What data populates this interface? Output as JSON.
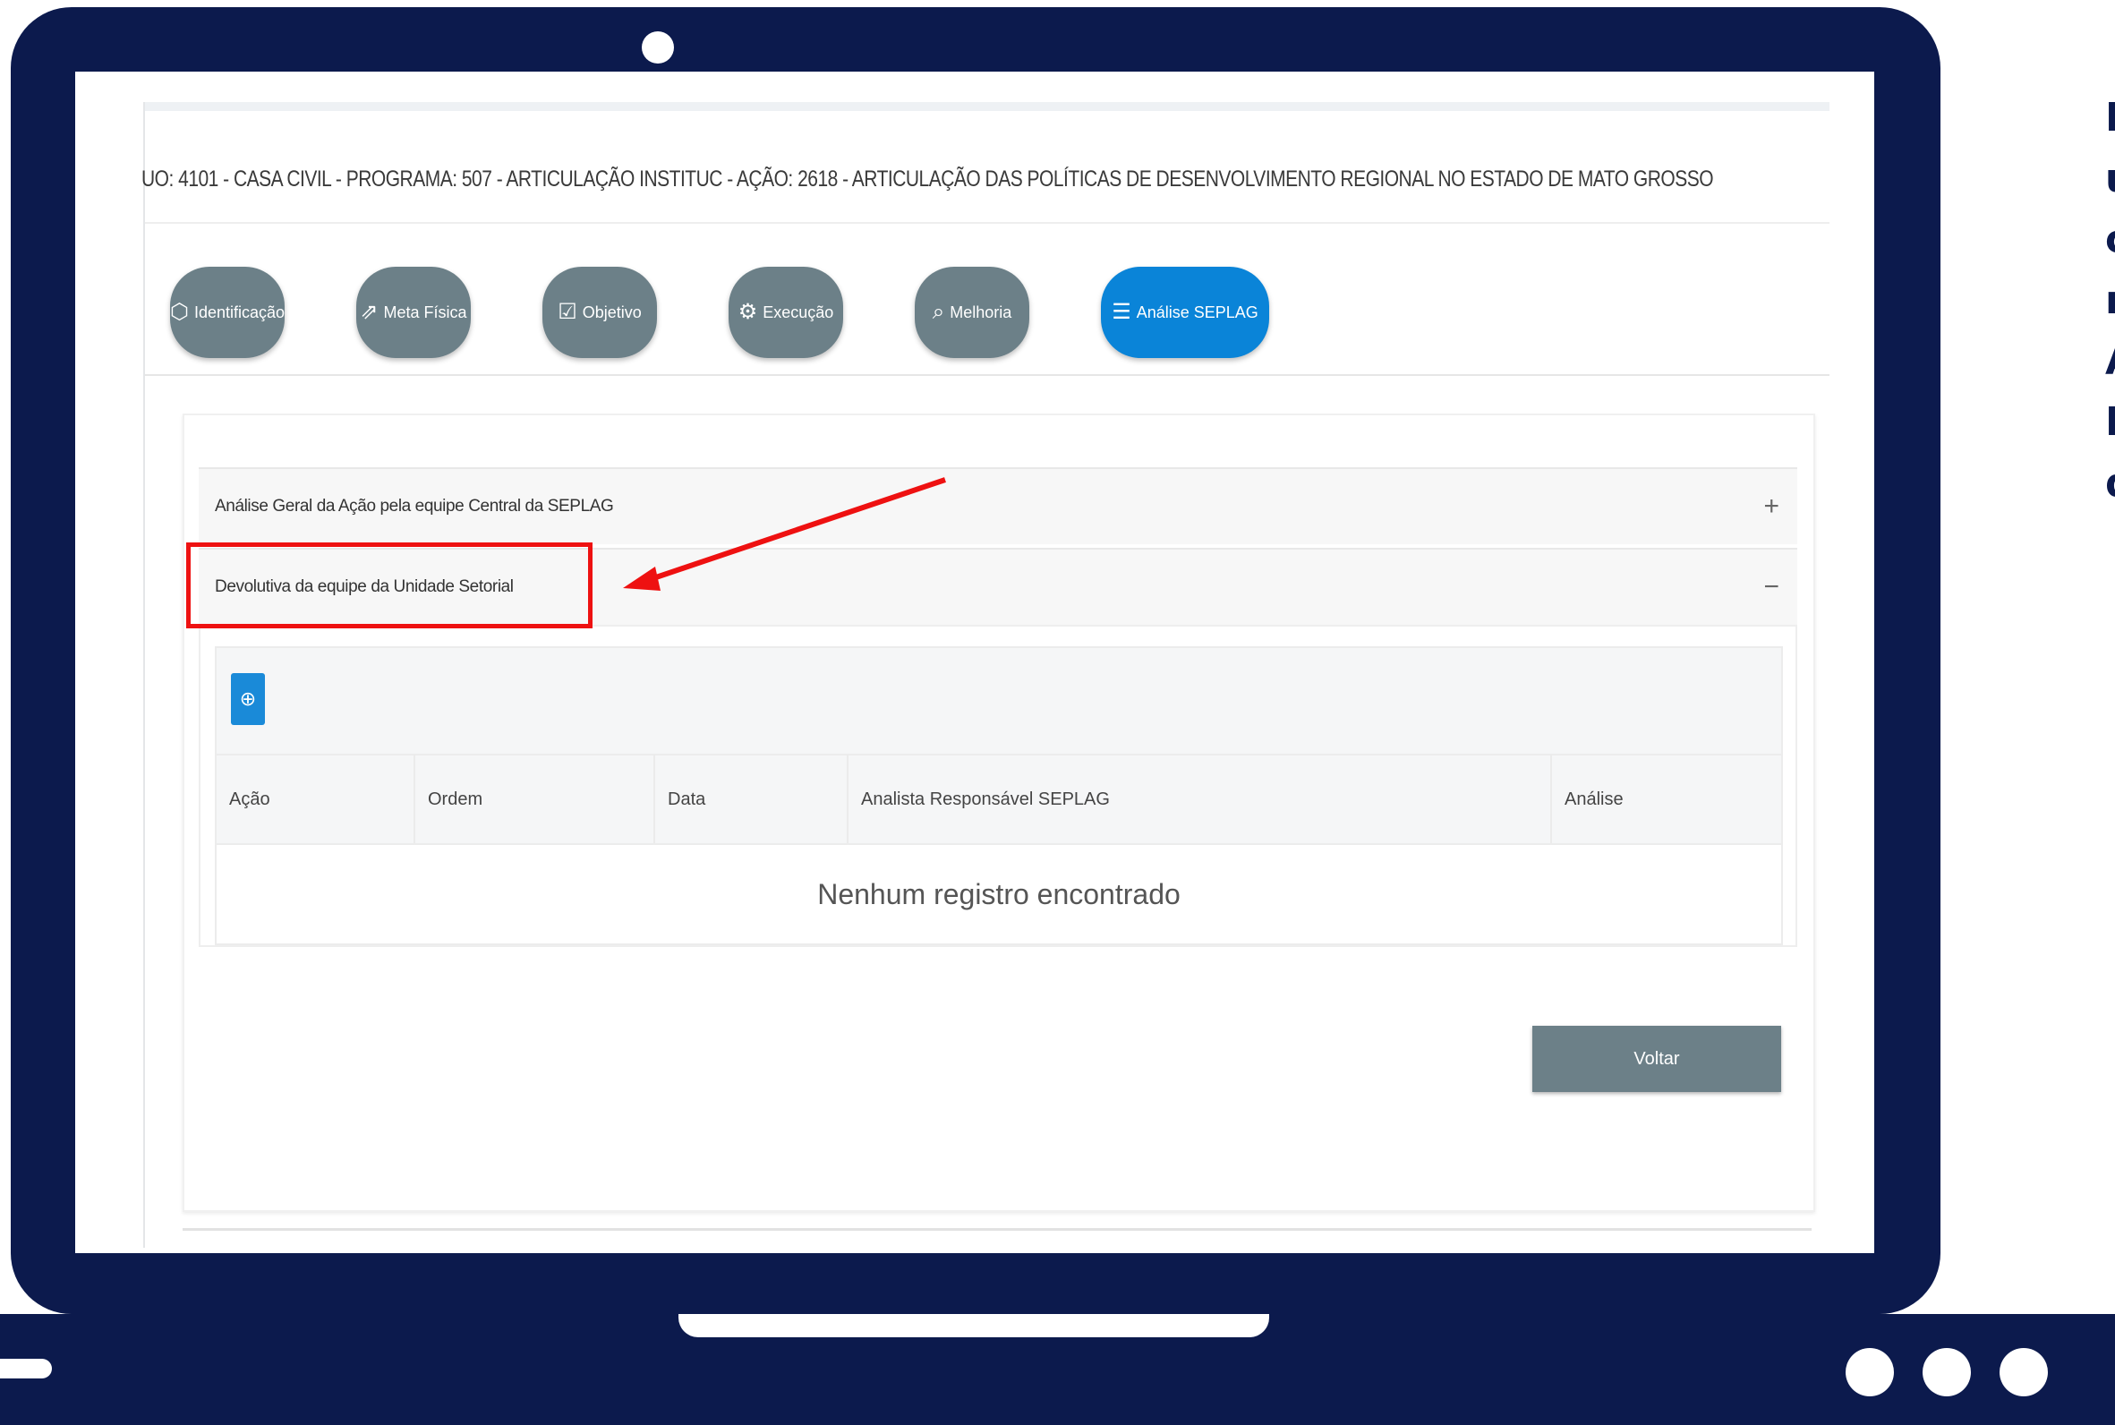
{
  "header": {
    "title": "UO: 4101 - CASA CIVIL - PROGRAMA: 507 - ARTICULAÇÃO INSTITUC - AÇÃO: 2618 - ARTICULAÇÃO DAS POLÍTICAS DE DESENVOLVIMENTO REGIONAL NO ESTADO DE MATO GROSSO"
  },
  "tabs": [
    {
      "label": "Identificação",
      "icon": "tag-icon"
    },
    {
      "label": "Meta Física",
      "icon": "chart-icon"
    },
    {
      "label": "Objetivo",
      "icon": "checkbox-icon"
    },
    {
      "label": "Execução",
      "icon": "gear-icon"
    },
    {
      "label": "Melhoria",
      "icon": "search-icon"
    },
    {
      "label": "Análise SEPLAG",
      "icon": "list-icon",
      "active": true
    }
  ],
  "accordion": {
    "general_analysis": {
      "label": "Análise Geral da Ação pela equipe Central da SEPLAG",
      "toggle": "+"
    },
    "feedback": {
      "label": "Devolutiva da equipe da Unidade Setorial",
      "toggle": "−"
    }
  },
  "table": {
    "add_icon": "plus-circle-icon",
    "columns": [
      "Ação",
      "Ordem",
      "Data",
      "Analista Responsável SEPLAG",
      "Análise"
    ],
    "empty_message": "Nenhum registro encontrado"
  },
  "buttons": {
    "back": "Voltar"
  },
  "side_text": [
    "E",
    "u",
    "c",
    "re",
    "A",
    "D",
    "d"
  ],
  "colors": {
    "frame": "#0c1a4d",
    "tab": "#6c8088",
    "tab_active": "#0a84d8",
    "annotation": "#ee1111"
  }
}
